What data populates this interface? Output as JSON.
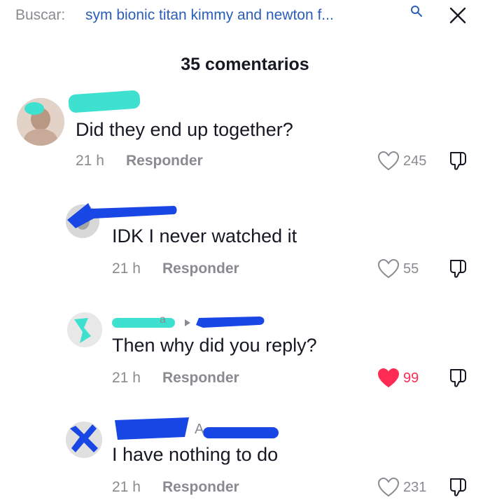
{
  "search": {
    "label": "Buscar:",
    "query": "sym bionic titan kimmy and newton f..."
  },
  "comments_header": "35 comentarios",
  "comments": [
    {
      "text": "Did they end up together?",
      "time": "21 h",
      "reply_label": "Responder",
      "likes": "245",
      "liked": false
    },
    {
      "text": "IDK I never watched it",
      "time": "21 h",
      "reply_label": "Responder",
      "likes": "55",
      "liked": false
    },
    {
      "text": "Then why did you reply?",
      "time": "21 h",
      "reply_label": "Responder",
      "likes": "99",
      "liked": true,
      "reply_fragment": "a"
    },
    {
      "text": "I have nothing to do",
      "time": "21 h",
      "reply_label": "Responder",
      "likes": "231",
      "liked": false,
      "reply_fragment": "A"
    }
  ],
  "colors": {
    "accent_blue": "#2b5db9",
    "liked_red": "#fe2c55",
    "redact_teal": "#3ee0d0",
    "redact_blue": "#1947e6",
    "muted_gray": "#8a8b91"
  }
}
